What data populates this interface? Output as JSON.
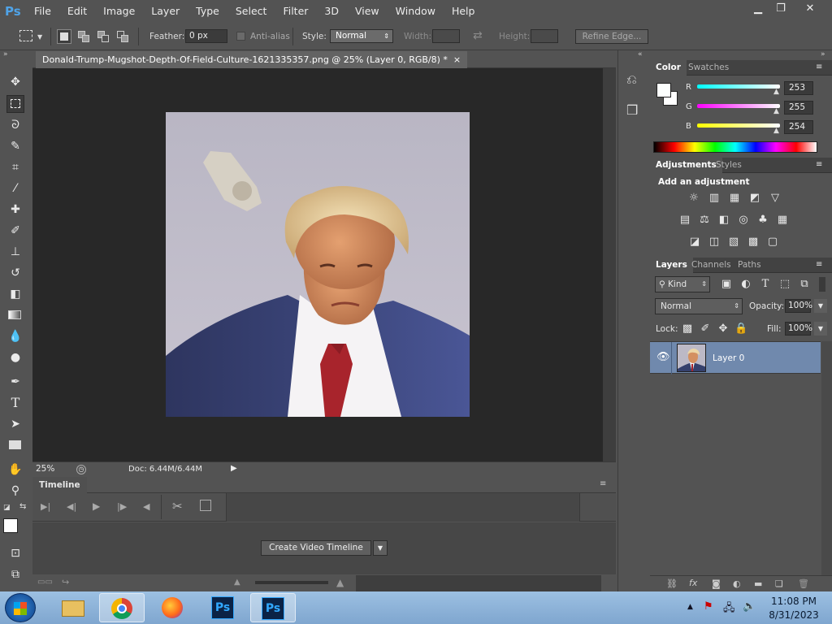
{
  "app": {
    "logo": "Ps"
  },
  "menu": [
    "File",
    "Edit",
    "Image",
    "Layer",
    "Type",
    "Select",
    "Filter",
    "3D",
    "View",
    "Window",
    "Help"
  ],
  "window_controls": {
    "minimize": "▁",
    "restore": "❐",
    "close": "✕"
  },
  "options": {
    "feather_label": "Feather:",
    "feather_value": "0 px",
    "antialias_label": "Anti-alias",
    "style_label": "Style:",
    "style_value": "Normal",
    "width_label": "Width:",
    "height_label": "Height:",
    "refine_edge": "Refine Edge..."
  },
  "document": {
    "tab_title": "Donald-Trump-Mugshot-Depth-Of-Field-Culture-1621335357.png @ 25% (Layer 0, RGB/8) *",
    "close": "×"
  },
  "status": {
    "zoom": "25%",
    "doc_size": "Doc: 6.44M/6.44M"
  },
  "timeline": {
    "title": "Timeline",
    "create_button": "Create Video Timeline"
  },
  "color_panel": {
    "tabs": [
      "Color",
      "Swatches"
    ],
    "r_label": "R",
    "g_label": "G",
    "b_label": "B",
    "r": "253",
    "g": "255",
    "b": "254",
    "foreground": "#fdfffe"
  },
  "adjustments_panel": {
    "tabs": [
      "Adjustments",
      "Styles"
    ],
    "heading": "Add an adjustment",
    "icons_row1": [
      "☼",
      "▥",
      "▦",
      "◩",
      "▽"
    ],
    "icons_row2": [
      "▤",
      "⚖",
      "◧",
      "◎",
      "♣",
      "▦"
    ],
    "icons_row3": [
      "◪",
      "◫",
      "▧",
      "▩",
      "▢"
    ]
  },
  "layers_panel": {
    "tabs": [
      "Layers",
      "Channels",
      "Paths"
    ],
    "kind": "Kind",
    "blend_mode": "Normal",
    "opacity_label": "Opacity:",
    "opacity": "100%",
    "lock_label": "Lock:",
    "fill_label": "Fill:",
    "fill": "100%",
    "layers": [
      {
        "name": "Layer 0",
        "visible": true
      }
    ]
  },
  "clock": {
    "time": "11:08 PM",
    "date": "8/31/2023"
  },
  "taskbar_icons": [
    "windows-start",
    "file-explorer",
    "chrome",
    "firefox",
    "photoshop",
    "photoshop-active"
  ]
}
